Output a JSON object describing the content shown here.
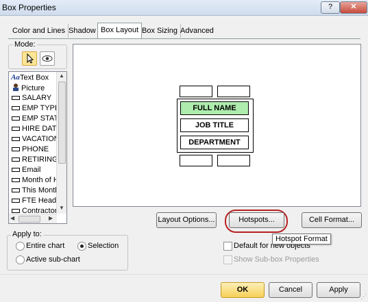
{
  "window": {
    "title": "Box Properties",
    "help_label": "?",
    "close_label": "✕"
  },
  "tabs": [
    {
      "label": "Color and Lines"
    },
    {
      "label": "Shadow"
    },
    {
      "label": "Box Layout",
      "active": true
    },
    {
      "label": "Box Sizing"
    },
    {
      "label": "Advanced"
    }
  ],
  "mode": {
    "label": "Mode:",
    "buttons": [
      {
        "icon": "pointer-icon",
        "selected": true
      },
      {
        "icon": "eye-icon",
        "selected": false
      }
    ]
  },
  "field_list": {
    "items": [
      {
        "label": "Text Box",
        "icon": "text-box-icon"
      },
      {
        "label": "Picture",
        "icon": "picture-icon"
      },
      {
        "label": "SALARY",
        "icon": "field-icon"
      },
      {
        "label": "EMP TYPE",
        "icon": "field-icon"
      },
      {
        "label": "EMP STAT",
        "icon": "field-icon"
      },
      {
        "label": "HIRE DATE",
        "icon": "field-icon"
      },
      {
        "label": "VACATION",
        "icon": "field-icon"
      },
      {
        "label": "PHONE",
        "icon": "field-icon"
      },
      {
        "label": "RETIRING",
        "icon": "field-icon"
      },
      {
        "label": "Email",
        "icon": "field-icon"
      },
      {
        "label": "Month of Hi",
        "icon": "field-icon"
      },
      {
        "label": "This Month",
        "icon": "field-icon"
      },
      {
        "label": "FTE Headc",
        "icon": "field-icon"
      },
      {
        "label": "Contractor",
        "icon": "field-icon"
      }
    ]
  },
  "layout_preview": {
    "fields": [
      {
        "label": "FULL NAME",
        "highlighted": true
      },
      {
        "label": "JOB TITLE",
        "highlighted": false
      },
      {
        "label": "DEPARTMENT",
        "highlighted": false
      }
    ]
  },
  "buttons": {
    "layout_options": "Layout Options...",
    "hotspots": "Hotspots...",
    "cell_format": "Cell Format...",
    "ok": "OK",
    "cancel": "Cancel",
    "apply": "Apply"
  },
  "tooltip": "Hotspot Format",
  "apply_to": {
    "label": "Apply to:",
    "options": [
      {
        "label": "Entire chart",
        "checked": false
      },
      {
        "label": "Selection",
        "checked": true
      },
      {
        "label": "Active sub-chart",
        "checked": false
      }
    ]
  },
  "checkboxes": {
    "default_new_objects": {
      "label": "Default for new objects",
      "checked": false,
      "enabled": true
    },
    "show_subbox": {
      "label": "Show Sub-box Properties",
      "checked": false,
      "enabled": false
    }
  }
}
